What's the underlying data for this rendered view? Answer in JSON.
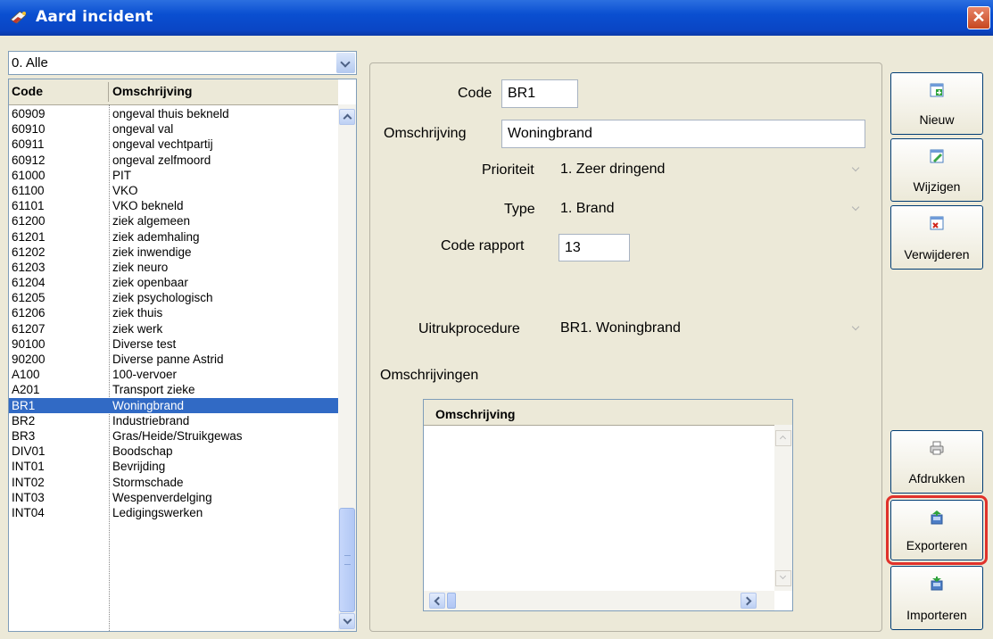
{
  "window": {
    "title": "Aard incident",
    "close_label": "✕"
  },
  "filter": {
    "selected": "0. Alle"
  },
  "list": {
    "headers": {
      "code": "Code",
      "description": "Omschrijving"
    },
    "rows": [
      [
        "60909",
        "ongeval thuis bekneld"
      ],
      [
        "60910",
        "ongeval val"
      ],
      [
        "60911",
        "ongeval vechtpartij"
      ],
      [
        "60912",
        "ongeval zelfmoord"
      ],
      [
        "61000",
        "PIT"
      ],
      [
        "61100",
        "VKO"
      ],
      [
        "61101",
        "VKO bekneld"
      ],
      [
        "61200",
        "ziek algemeen"
      ],
      [
        "61201",
        "ziek ademhaling"
      ],
      [
        "61202",
        "ziek inwendige"
      ],
      [
        "61203",
        "ziek neuro"
      ],
      [
        "61204",
        "ziek openbaar"
      ],
      [
        "61205",
        "ziek psychologisch"
      ],
      [
        "61206",
        "ziek thuis"
      ],
      [
        "61207",
        "ziek werk"
      ],
      [
        "90100",
        "Diverse test"
      ],
      [
        "90200",
        "Diverse panne Astrid"
      ],
      [
        "A100",
        "100-vervoer"
      ],
      [
        "A201",
        "Transport zieke"
      ],
      [
        "BR1",
        "Woningbrand"
      ],
      [
        "BR2",
        "Industriebrand"
      ],
      [
        "BR3",
        "Gras/Heide/Struikgewas"
      ],
      [
        "DIV01",
        "Boodschap"
      ],
      [
        "INT01",
        "Bevrijding"
      ],
      [
        "INT02",
        "Stormschade"
      ],
      [
        "INT03",
        "Wespenverdelging"
      ],
      [
        "INT04",
        "Ledigingswerken"
      ]
    ],
    "selected_code": "BR1"
  },
  "detail": {
    "code_label": "Code",
    "code_value": "BR1",
    "omschrijving_label": "Omschrijving",
    "omschrijving_value": "Woningbrand",
    "prioriteit_label": "Prioriteit",
    "prioriteit_value": "1. Zeer dringend",
    "type_label": "Type",
    "type_value": "1. Brand",
    "code_rapport_label": "Code rapport",
    "code_rapport_value": "13",
    "uitrukprocedure_label": "Uitrukprocedure",
    "uitrukprocedure_value": "BR1. Woningbrand",
    "omschrijvingen_label": "Omschrijvingen",
    "grid_header": "Omschrijving"
  },
  "buttons": {
    "nieuw": "Nieuw",
    "wijzigen": "Wijzigen",
    "verwijderen": "Verwijderen",
    "afdrukken": "Afdrukken",
    "exporteren": "Exporteren",
    "importeren": "Importeren"
  },
  "icons": {
    "title": "flame-truck-icon",
    "nieuw": "new-document-icon",
    "wijzigen": "edit-document-icon",
    "verwijderen": "delete-document-icon",
    "afdrukken": "printer-icon",
    "exporteren": "export-icon",
    "importeren": "import-icon"
  },
  "colors": {
    "titlebar": "#0a4fd1",
    "selection": "#316ac5",
    "highlight_outline": "#e0322b",
    "window_bg": "#ece9d8"
  }
}
